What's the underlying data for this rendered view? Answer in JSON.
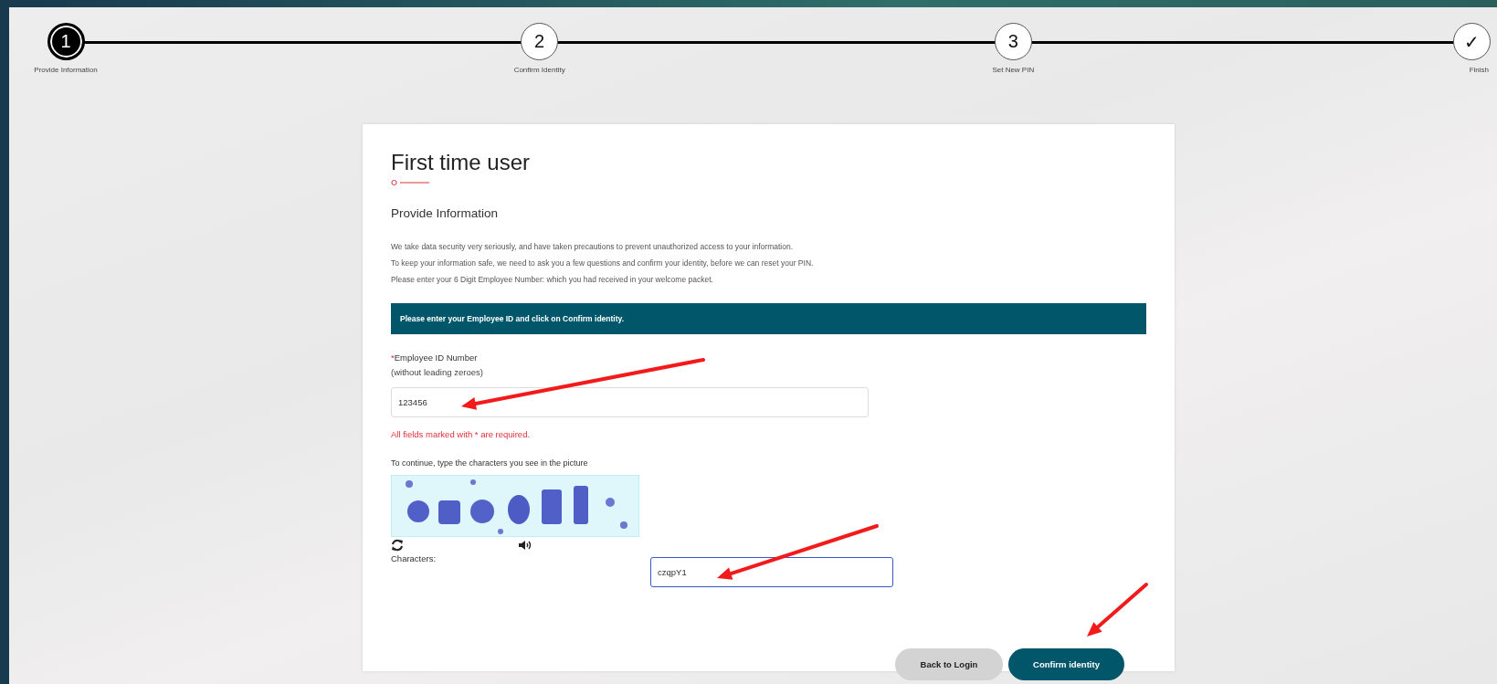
{
  "steps": [
    {
      "marker": "1",
      "label": "Provide Information",
      "current": true
    },
    {
      "marker": "2",
      "label": "Confirm Identity",
      "current": false
    },
    {
      "marker": "3",
      "label": "Set New PIN",
      "current": false
    },
    {
      "marker": "✓",
      "label": "Finish",
      "current": false
    }
  ],
  "card": {
    "title": "First time user",
    "subtitle": "Provide Information",
    "paragraphs": [
      "We take data security very seriously, and have taken precautions to prevent unauthorized access to your information.",
      "To keep your information safe, we need to ask you a few questions and confirm your identity, before we can reset your PIN.",
      "Please enter your 6 Digit Employee Number: which you had received in your welcome packet."
    ],
    "banner": "Please enter your Employee ID and click on Confirm identity.",
    "employee_field": {
      "required_mark": "*",
      "label": "Employee ID Number",
      "hint": "(without leading zeroes)",
      "value": "123456",
      "focused": false
    },
    "required_note": "All fields marked with * are required.",
    "captcha": {
      "instruction": "To continue, type the characters you see in the picture",
      "input_label": "Characters:",
      "value": "czqpY1",
      "focused": true
    },
    "buttons": [
      {
        "label": "Back to Login",
        "kind": "secondary"
      },
      {
        "label": "Confirm identity",
        "kind": "primary"
      }
    ]
  }
}
